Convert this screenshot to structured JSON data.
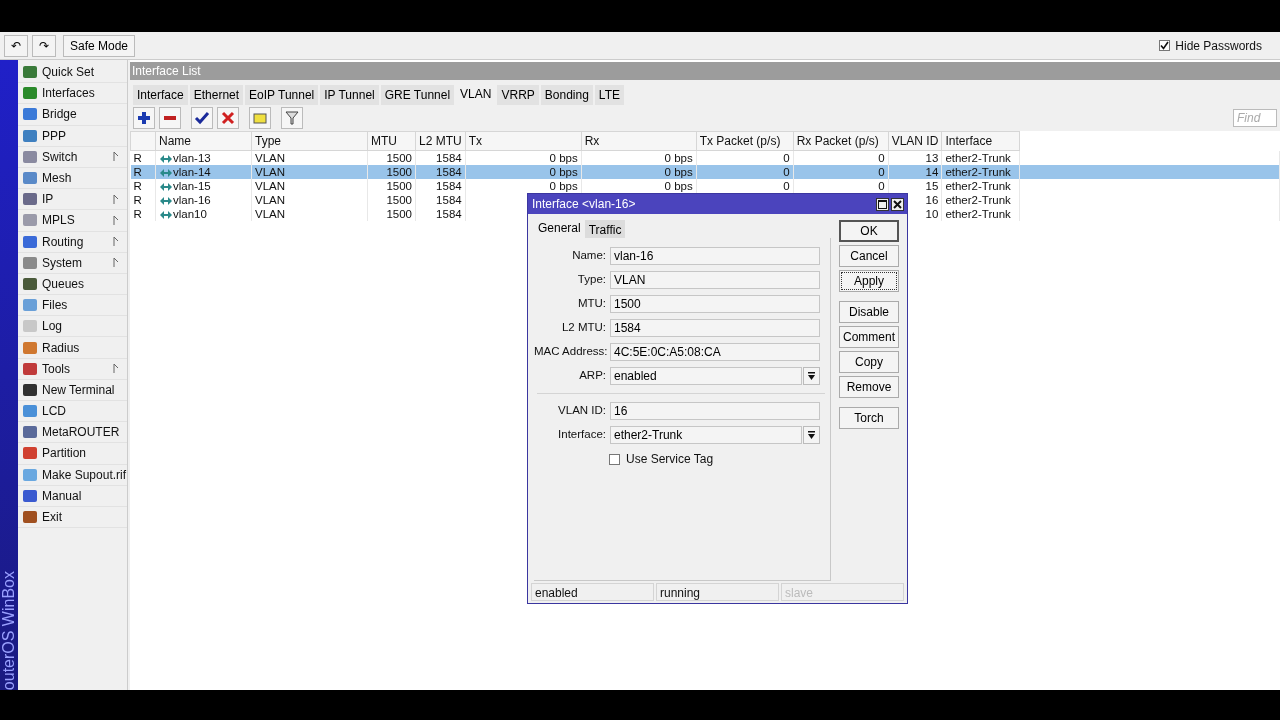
{
  "toolbar": {
    "undo": "↶",
    "redo": "↷",
    "safe_mode": "Safe Mode",
    "hide_passwords": {
      "label": "Hide Passwords",
      "checked": true
    }
  },
  "side_label": "outerOS WinBox",
  "sidebar": {
    "items": [
      {
        "label": "Quick Set",
        "submenu": false
      },
      {
        "label": "Interfaces",
        "submenu": false
      },
      {
        "label": "Bridge",
        "submenu": false
      },
      {
        "label": "PPP",
        "submenu": false
      },
      {
        "label": "Switch",
        "submenu": true
      },
      {
        "label": "Mesh",
        "submenu": false
      },
      {
        "label": "IP",
        "submenu": true
      },
      {
        "label": "MPLS",
        "submenu": true
      },
      {
        "label": "Routing",
        "submenu": true
      },
      {
        "label": "System",
        "submenu": true
      },
      {
        "label": "Queues",
        "submenu": false
      },
      {
        "label": "Files",
        "submenu": false
      },
      {
        "label": "Log",
        "submenu": false
      },
      {
        "label": "Radius",
        "submenu": false
      },
      {
        "label": "Tools",
        "submenu": true
      },
      {
        "label": "New Terminal",
        "submenu": false
      },
      {
        "label": "LCD",
        "submenu": false
      },
      {
        "label": "MetaROUTER",
        "submenu": false
      },
      {
        "label": "Partition",
        "submenu": false
      },
      {
        "label": "Make Supout.rif",
        "submenu": false
      },
      {
        "label": "Manual",
        "submenu": false
      },
      {
        "label": "Exit",
        "submenu": false
      }
    ]
  },
  "window": {
    "title": "Interface List",
    "tabs": [
      {
        "label": "Interface",
        "selected": false
      },
      {
        "label": "Ethernet",
        "selected": false
      },
      {
        "label": "EoIP Tunnel",
        "selected": false
      },
      {
        "label": "IP Tunnel",
        "selected": false
      },
      {
        "label": "GRE Tunnel",
        "selected": false
      },
      {
        "label": "VLAN",
        "selected": true
      },
      {
        "label": "VRRP",
        "selected": false
      },
      {
        "label": "Bonding",
        "selected": false
      },
      {
        "label": "LTE",
        "selected": false
      }
    ],
    "find": {
      "placeholder": "Find"
    },
    "table": {
      "columns": [
        "",
        "Name",
        "Type",
        "MTU",
        "L2 MTU",
        "Tx",
        "Rx",
        "Tx Packet (p/s)",
        "Rx Packet (p/s)",
        "VLAN ID",
        "Interface"
      ],
      "rows": [
        {
          "flag": "R",
          "name": "vlan-13",
          "type": "VLAN",
          "mtu": "1500",
          "l2mtu": "1584",
          "tx": "0 bps",
          "rx": "0 bps",
          "tx_packet": "0",
          "rx_packet": "0",
          "vlan_id": "13",
          "interface": "ether2-Trunk",
          "selected": false
        },
        {
          "flag": "R",
          "name": "vlan-14",
          "type": "VLAN",
          "mtu": "1500",
          "l2mtu": "1584",
          "tx": "0 bps",
          "rx": "0 bps",
          "tx_packet": "0",
          "rx_packet": "0",
          "vlan_id": "14",
          "interface": "ether2-Trunk",
          "selected": true
        },
        {
          "flag": "R",
          "name": "vlan-15",
          "type": "VLAN",
          "mtu": "1500",
          "l2mtu": "1584",
          "tx": "0 bps",
          "rx": "0 bps",
          "tx_packet": "0",
          "rx_packet": "0",
          "vlan_id": "15",
          "interface": "ether2-Trunk",
          "selected": false
        },
        {
          "flag": "R",
          "name": "vlan-16",
          "type": "VLAN",
          "mtu": "1500",
          "l2mtu": "1584",
          "vlan_id": "16",
          "interface": "ether2-Trunk",
          "selected": false
        },
        {
          "flag": "R",
          "name": "vlan10",
          "type": "VLAN",
          "mtu": "1500",
          "l2mtu": "1584",
          "vlan_id": "10",
          "interface": "ether2-Trunk",
          "selected": false
        }
      ]
    }
  },
  "dialog": {
    "title": "Interface <vlan-16>",
    "tabs": [
      {
        "label": "General",
        "selected": true
      },
      {
        "label": "Traffic",
        "selected": false
      }
    ],
    "fields": [
      {
        "label": "Name:",
        "value": "vlan-16",
        "kind": "text"
      },
      {
        "label": "Type:",
        "value": "VLAN",
        "kind": "text"
      },
      {
        "label": "MTU:",
        "value": "1500",
        "kind": "text"
      },
      {
        "label": "L2 MTU:",
        "value": "1584",
        "kind": "text"
      },
      {
        "label": "MAC Address:",
        "value": "4C:5E:0C:A5:08:CA",
        "kind": "text"
      },
      {
        "label": "ARP:",
        "value": "enabled",
        "kind": "select"
      },
      {
        "kind": "separator"
      },
      {
        "label": "VLAN ID:",
        "value": "16",
        "kind": "text"
      },
      {
        "label": "Interface:",
        "value": "ether2-Trunk",
        "kind": "select"
      },
      {
        "label": "Use Service Tag",
        "checked": false,
        "kind": "checkbox"
      }
    ],
    "button_groups": [
      [
        {
          "label": "OK",
          "default": true,
          "focused": false
        },
        {
          "label": "Cancel",
          "default": false,
          "focused": false
        },
        {
          "label": "Apply",
          "default": false,
          "focused": true
        }
      ],
      [
        {
          "label": "Disable",
          "default": false,
          "focused": false
        },
        {
          "label": "Comment",
          "default": false,
          "focused": false
        },
        {
          "label": "Copy",
          "default": false,
          "focused": false
        },
        {
          "label": "Remove",
          "default": false,
          "focused": false
        }
      ],
      [
        {
          "label": "Torch",
          "default": false,
          "focused": false
        }
      ]
    ],
    "status": [
      {
        "text": "enabled",
        "disabled": false
      },
      {
        "text": "running",
        "disabled": false
      },
      {
        "text": "slave",
        "disabled": true
      }
    ]
  }
}
